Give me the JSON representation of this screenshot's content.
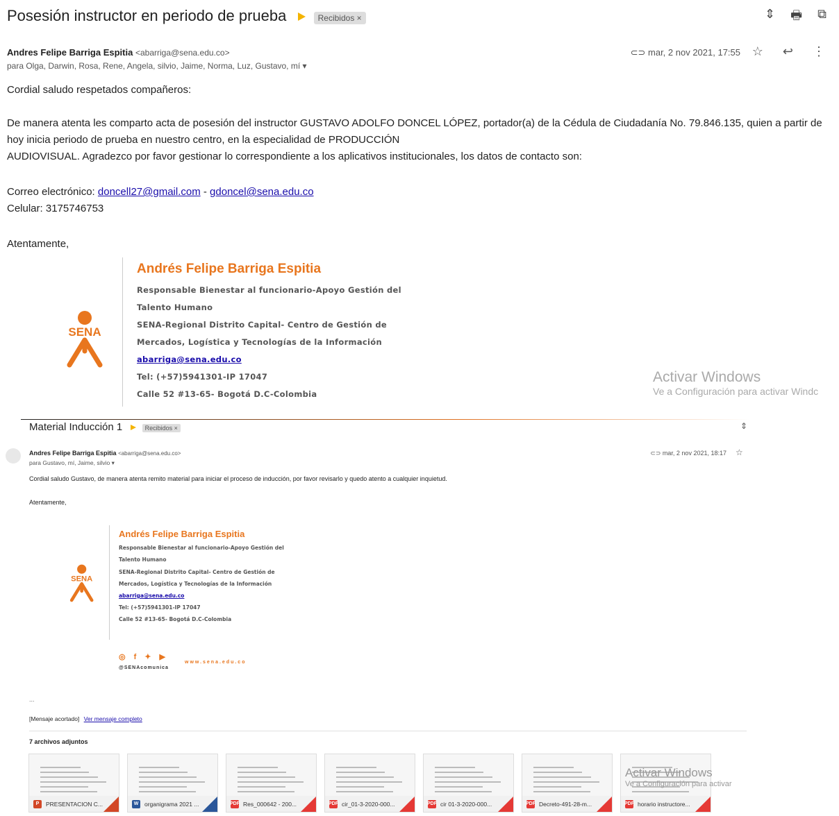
{
  "email1": {
    "subject": "Posesión instructor en periodo de prueba",
    "label": "Recibidos ×",
    "sender_name": "Andres Felipe Barriga Espitia",
    "sender_email": "<abarriga@sena.edu.co>",
    "to": "para Olga, Darwin, Rosa, Rene, Angela, silvio, Jaime, Norma, Luz, Gustavo, mí",
    "date": "mar, 2 nov 2021, 17:55",
    "greeting": "Cordial saludo respetados compañeros:",
    "para1_line1": "De manera atenta les comparto acta de posesión del instructor GUSTAVO ADOLFO DONCEL LÓPEZ, portador(a) de la Cédula de Ciudadanía No. 79.846.135, quien a partir de",
    "para1_line2": "hoy inicia periodo de prueba en nuestro centro, en la especialidad de PRODUCCIÓN",
    "para1_line3": "AUDIOVISUAL. Agradezco por favor gestionar lo correspondiente a los aplicativos institucionales, los datos de contacto son:",
    "email_label": "Correo electrónico: ",
    "email_a": "doncell27@gmail.com",
    "email_sep": " - ",
    "email_b": "gdoncel@sena.edu.co",
    "phone": "Celular:  3175746753",
    "closing": "Atentamente,"
  },
  "signature": {
    "name": "Andrés Felipe Barriga Espitia",
    "line1": "Responsable Bienestar al funcionario-Apoyo Gestión del",
    "line2": "Talento Humano",
    "line3": "SENA-Regional Distrito Capital- Centro de Gestión de",
    "line4": "Mercados, Logística y Tecnologías de la Información",
    "email": "abarriga@sena.edu.co",
    "tel": "Tel: (+57)5941301-IP 17047",
    "address": "Calle 52 #13-65- Bogotá D.C-Colombia",
    "logo_text": "SENA"
  },
  "watermark": {
    "title": "Activar Windows",
    "subtitle": "Ve a Configuración para activar Windc",
    "subtitle2": "Ve a Configuración para activar"
  },
  "email2": {
    "subject": "Material Inducción 1",
    "label": "Recibidos ×",
    "sender_name": "Andres Felipe Barriga Espitia",
    "sender_email": "<abarriga@sena.edu.co>",
    "to": "para Gustavo, mí, Jaime, silvio",
    "date": "mar, 2 nov 2021, 18:17",
    "body": "Cordial saludo Gustavo, de manera atenta remito material para iniciar el proceso de inducción, por favor revisarlo y quedo atento a cualquier inquietud.",
    "closing": "Atentamente,",
    "ellipsis": "...",
    "trimmed": "[Mensaje acortado]",
    "view_full": "Ver mensaje completo",
    "social_handle": "@SENAcomunica",
    "website": "www.sena.edu.co",
    "attachments_title": "7 archivos adjuntos",
    "attachments": [
      {
        "name": "PRESENTACION C...",
        "type": "P",
        "color": "#d24726"
      },
      {
        "name": "organigrama 2021 ...",
        "type": "W",
        "color": "#2b579a"
      },
      {
        "name": "Res_000642 - 200...",
        "type": "PDF",
        "color": "#e53935"
      },
      {
        "name": "cir_01-3-2020-000...",
        "type": "PDF",
        "color": "#e53935"
      },
      {
        "name": "cir 01-3-2020-000...",
        "type": "PDF",
        "color": "#e53935"
      },
      {
        "name": "Decreto-491-28-m...",
        "type": "PDF",
        "color": "#e53935"
      },
      {
        "name": "horario instructore...",
        "type": "PDF",
        "color": "#e53935"
      }
    ]
  }
}
